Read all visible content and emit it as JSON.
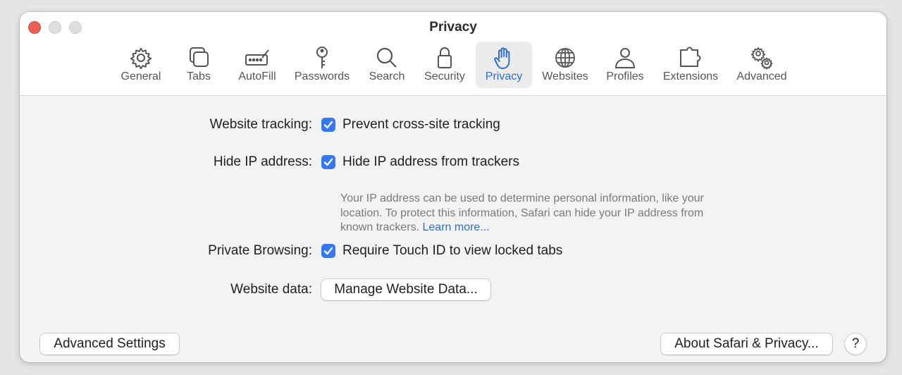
{
  "window": {
    "title": "Privacy"
  },
  "toolbar": {
    "items": [
      {
        "label": "General",
        "icon": "gear-icon"
      },
      {
        "label": "Tabs",
        "icon": "tabs-icon"
      },
      {
        "label": "AutoFill",
        "icon": "autofill-icon"
      },
      {
        "label": "Passwords",
        "icon": "key-icon"
      },
      {
        "label": "Search",
        "icon": "magnifier-icon"
      },
      {
        "label": "Security",
        "icon": "lock-icon"
      },
      {
        "label": "Privacy",
        "icon": "hand-icon",
        "selected": true
      },
      {
        "label": "Websites",
        "icon": "globe-icon"
      },
      {
        "label": "Profiles",
        "icon": "person-icon"
      },
      {
        "label": "Extensions",
        "icon": "puzzle-icon"
      },
      {
        "label": "Advanced",
        "icon": "gears-icon"
      }
    ]
  },
  "settings": {
    "tracking": {
      "label": "Website tracking:",
      "option": "Prevent cross-site tracking",
      "checked": true
    },
    "hide_ip": {
      "label": "Hide IP address:",
      "option": "Hide IP address from trackers",
      "checked": true,
      "description": "Your IP address can be used to determine personal information, like your location. To protect this information, Safari can hide your IP address from known trackers.",
      "link": "Learn more..."
    },
    "private_browsing": {
      "label": "Private Browsing:",
      "option": "Require Touch ID to view locked tabs",
      "checked": true
    },
    "website_data": {
      "label": "Website data:",
      "button": "Manage Website Data..."
    }
  },
  "footer": {
    "advanced_button": "Advanced Settings",
    "about_button": "About Safari & Privacy...",
    "help_button": "?"
  },
  "colors": {
    "accent": "#3478f6",
    "link": "#2d6fd6",
    "close": "#ec5f56"
  }
}
